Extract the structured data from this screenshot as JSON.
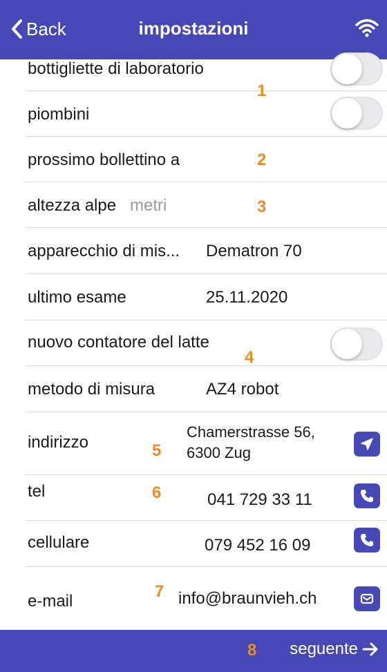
{
  "navbar": {
    "back_label": "Back",
    "title": "impostazioni"
  },
  "rows": {
    "lab_bottles": {
      "label": "bottigliette di laboratorio",
      "toggle_on": false
    },
    "seals": {
      "label": "piombini",
      "toggle_on": false
    },
    "next_bulletin": {
      "label": "prossimo bollettino a",
      "value": ""
    },
    "alp_altitude": {
      "label": "altezza alpe",
      "placeholder": "metri"
    },
    "device": {
      "label": "apparecchio di mis...",
      "value": "Dematron 70"
    },
    "last_exam": {
      "label": "ultimo esame",
      "value": "25.11.2020"
    },
    "new_counter": {
      "label": "nuovo contatore del latte",
      "toggle_on": false
    },
    "method": {
      "label": "metodo di misura",
      "value": "AZ4 robot"
    },
    "address": {
      "label": "indirizzo",
      "line1": "Chamerstrasse 56,",
      "line2": "6300 Zug"
    },
    "phone": {
      "label": "tel",
      "value": "041 729 33 11"
    },
    "mobile": {
      "label": "cellulare",
      "value": "079 452 16 09"
    },
    "email": {
      "label": "e-mail",
      "value": "info@braunvieh.ch"
    }
  },
  "markers": [
    "1",
    "2",
    "3",
    "4",
    "5",
    "6",
    "7",
    "8"
  ],
  "footer": {
    "next_label": "seguente"
  },
  "icons": {
    "back": "chevron-left-icon",
    "wifi": "wifi-icon",
    "navigate": "location-arrow-icon",
    "phone": "phone-icon",
    "mail": "mail-icon",
    "next": "arrow-right-icon"
  },
  "colors": {
    "accent": "#4648b6",
    "marker": "#f08a24",
    "placeholder": "#9a9a9a"
  }
}
